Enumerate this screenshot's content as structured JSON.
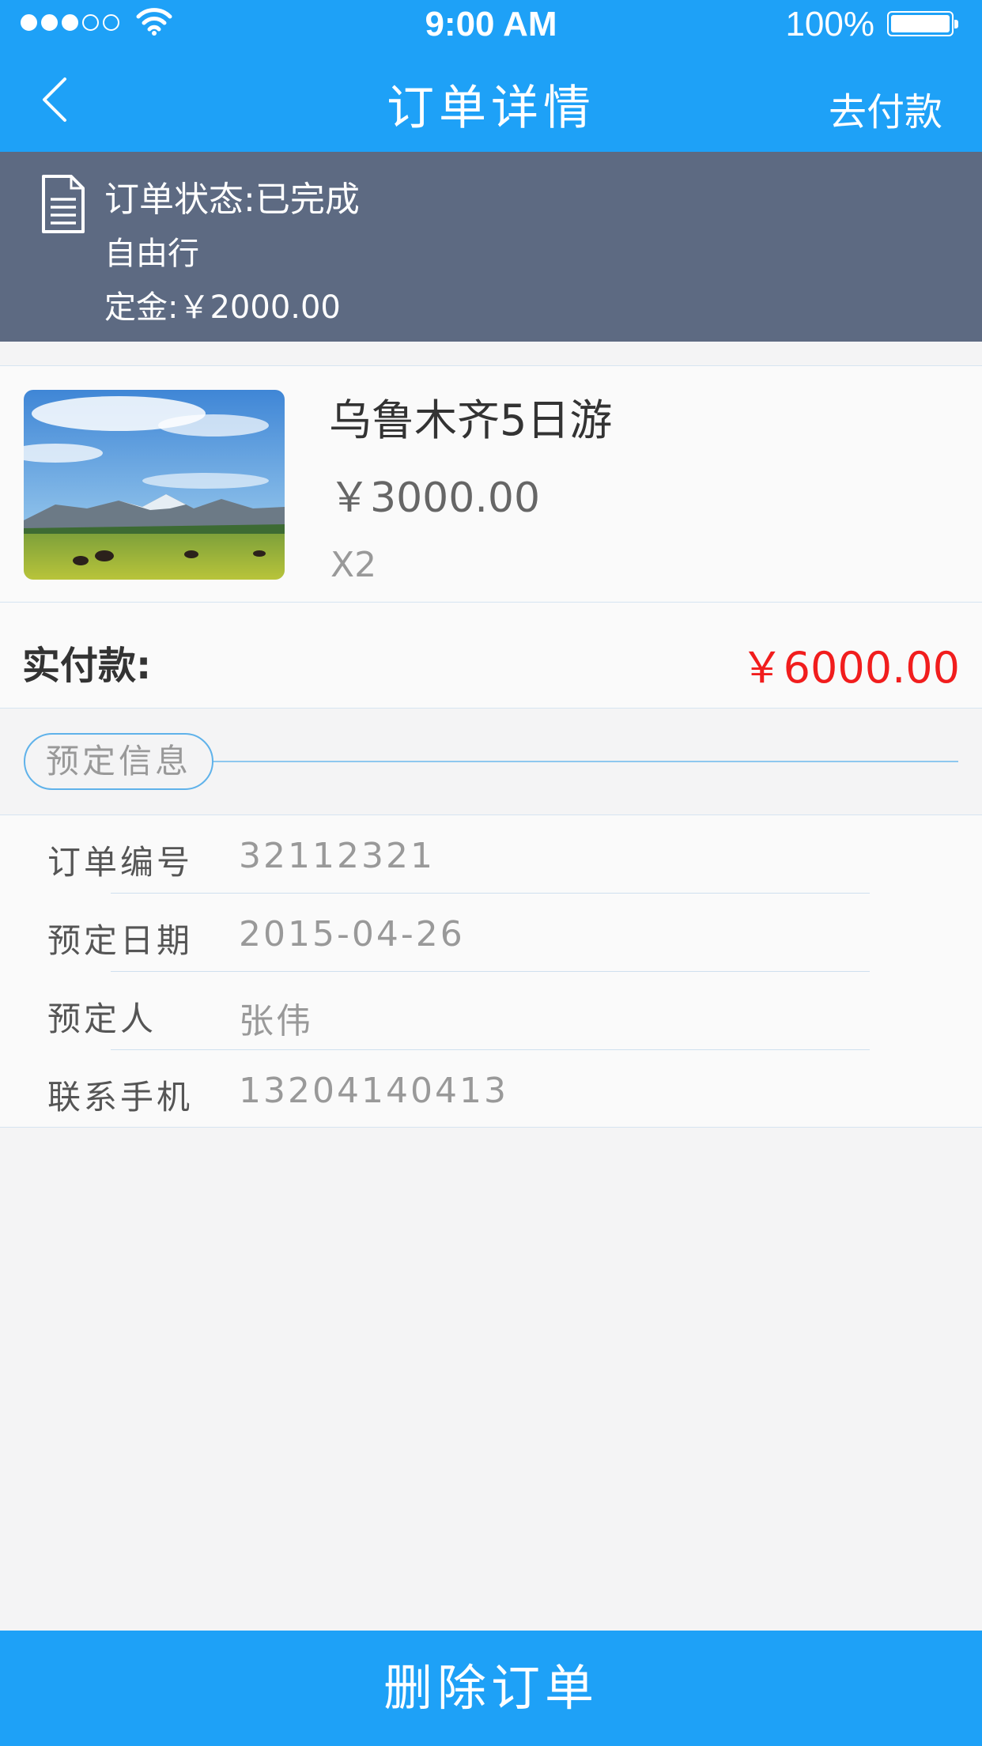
{
  "status_bar": {
    "time": "9:00 AM",
    "battery": "100%",
    "signal_bars": 5,
    "signal_filled": 3
  },
  "nav": {
    "title": "订单详情",
    "action": "去付款"
  },
  "order_status": {
    "status": "订单状态:已完成",
    "type": "自由行",
    "deposit": "定金:￥2000.00"
  },
  "product": {
    "name": "乌鲁木齐5日游",
    "price": "￥3000.00",
    "quantity": "X2"
  },
  "payment": {
    "label": "实付款:",
    "amount": "￥6000.00"
  },
  "section": {
    "title": "预定信息"
  },
  "booking_info": [
    {
      "label": "订单编号",
      "value": "32112321"
    },
    {
      "label": "预定日期",
      "value": "2015-04-26"
    },
    {
      "label": "预定人",
      "value": "张伟"
    },
    {
      "label": "联系手机",
      "value": "13204140413"
    }
  ],
  "bottom_button": {
    "label": "删除订单"
  },
  "colors": {
    "primary": "#1ea1f7",
    "status_band": "#5d6a82",
    "price_red": "#f11d1d"
  }
}
